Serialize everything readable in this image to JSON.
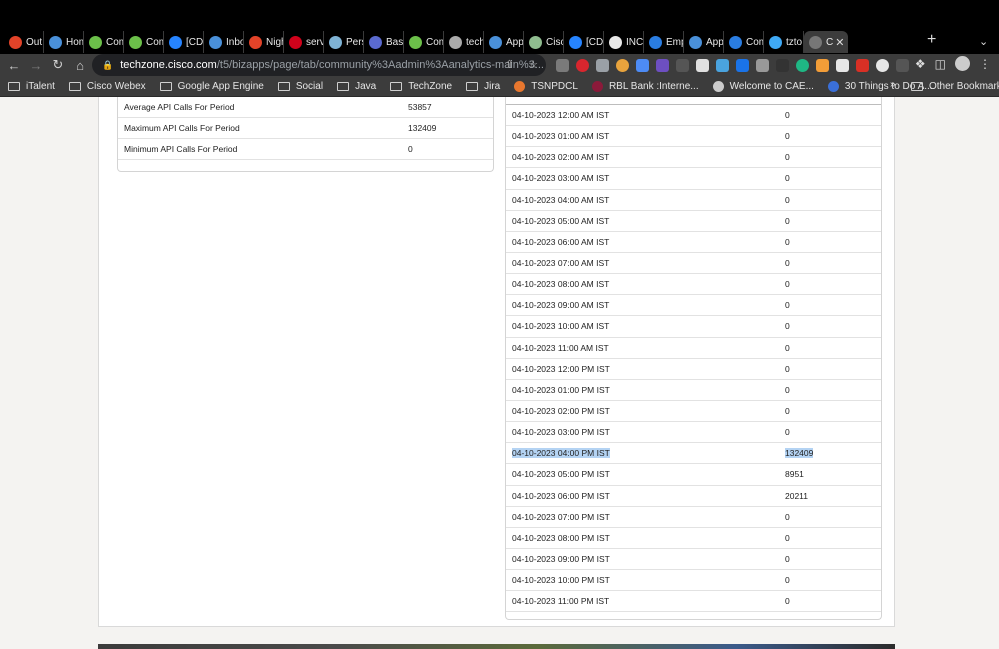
{
  "tabs": [
    {
      "label": "Out",
      "icon": "gitlab-icon",
      "color": "#e24329"
    },
    {
      "label": "Hom",
      "icon": "calendar-icon",
      "color": "#4a90d9"
    },
    {
      "label": "Com",
      "icon": "techzone-icon",
      "color": "#6cc04a"
    },
    {
      "label": "Com",
      "icon": "techzone-icon",
      "color": "#6cc04a"
    },
    {
      "label": "[CD",
      "icon": "jira-icon",
      "color": "#2684ff"
    },
    {
      "label": "Inbo",
      "icon": "confluence-icon",
      "color": "#4a90d9"
    },
    {
      "label": "Nigh",
      "icon": "gitlab-icon",
      "color": "#e24329"
    },
    {
      "label": "serv",
      "icon": "target-icon",
      "color": "#d0021b"
    },
    {
      "label": "Pers",
      "icon": "doc-icon",
      "color": "#7fb3d5"
    },
    {
      "label": "Bash",
      "icon": "atom-icon",
      "color": "#5a6acf"
    },
    {
      "label": "Com",
      "icon": "techzone-icon",
      "color": "#6cc04a"
    },
    {
      "label": "tech",
      "icon": "globe-icon",
      "color": "#aaaaaa"
    },
    {
      "label": "Appi",
      "icon": "confluence-icon",
      "color": "#4a90d9"
    },
    {
      "label": "Cisc",
      "icon": "cisco-icon",
      "color": "#8fbc8f"
    },
    {
      "label": "[CD",
      "icon": "jira-icon",
      "color": "#2684ff"
    },
    {
      "label": "INCI",
      "icon": "doc-icon",
      "color": "#e8e8e8"
    },
    {
      "label": "Emp",
      "icon": "cae-icon",
      "color": "#2a7de1"
    },
    {
      "label": "App",
      "icon": "confluence-icon",
      "color": "#4a90d9"
    },
    {
      "label": "Com",
      "icon": "shield-icon",
      "color": "#2a7de1"
    },
    {
      "label": "tzto",
      "icon": "feather-icon",
      "color": "#3fa9f5"
    }
  ],
  "active_tab": {
    "label": "C",
    "icon": "globe-icon"
  },
  "address_bar": {
    "host": "techzone.cisco.com",
    "path": "/t5/bizapps/page/tab/community%3Aadmin%3Aanalytics-main%3..."
  },
  "bookmarks": [
    {
      "label": "iTalent",
      "icon": "folder-icon"
    },
    {
      "label": "Cisco Webex",
      "icon": "folder-icon"
    },
    {
      "label": "Google App Engine",
      "icon": "folder-icon"
    },
    {
      "label": "Social",
      "icon": "folder-icon"
    },
    {
      "label": "Java",
      "icon": "folder-icon"
    },
    {
      "label": "TechZone",
      "icon": "folder-icon"
    },
    {
      "label": "Jira",
      "icon": "folder-icon"
    },
    {
      "label": "TSNPDCL",
      "icon": "tsnpdcl-icon"
    },
    {
      "label": "RBL Bank :Interne...",
      "icon": "rbl-icon"
    },
    {
      "label": "Welcome to CAE...",
      "icon": "globe-icon"
    },
    {
      "label": "30 Things to Do A...",
      "icon": "info-icon"
    }
  ],
  "other_bookmarks": "Other Bookmarks",
  "more_bookmarks": "»",
  "summary": [
    {
      "name": "Average API Calls For Period",
      "value": "53857"
    },
    {
      "name": "Maximum API Calls For Period",
      "value": "132409"
    },
    {
      "name": "Minimum API Calls For Period",
      "value": "0"
    }
  ],
  "hourly": [
    {
      "time": "04-10-2023 12:00 AM IST",
      "count": "0"
    },
    {
      "time": "04-10-2023 01:00 AM IST",
      "count": "0"
    },
    {
      "time": "04-10-2023 02:00 AM IST",
      "count": "0"
    },
    {
      "time": "04-10-2023 03:00 AM IST",
      "count": "0"
    },
    {
      "time": "04-10-2023 04:00 AM IST",
      "count": "0"
    },
    {
      "time": "04-10-2023 05:00 AM IST",
      "count": "0"
    },
    {
      "time": "04-10-2023 06:00 AM IST",
      "count": "0"
    },
    {
      "time": "04-10-2023 07:00 AM IST",
      "count": "0"
    },
    {
      "time": "04-10-2023 08:00 AM IST",
      "count": "0"
    },
    {
      "time": "04-10-2023 09:00 AM IST",
      "count": "0"
    },
    {
      "time": "04-10-2023 10:00 AM IST",
      "count": "0"
    },
    {
      "time": "04-10-2023 11:00 AM IST",
      "count": "0"
    },
    {
      "time": "04-10-2023 12:00 PM IST",
      "count": "0"
    },
    {
      "time": "04-10-2023 01:00 PM IST",
      "count": "0"
    },
    {
      "time": "04-10-2023 02:00 PM IST",
      "count": "0"
    },
    {
      "time": "04-10-2023 03:00 PM IST",
      "count": "0"
    },
    {
      "time": "04-10-2023 04:00 PM IST",
      "count": "132409",
      "highlighted": true
    },
    {
      "time": "04-10-2023 05:00 PM IST",
      "count": "8951"
    },
    {
      "time": "04-10-2023 06:00 PM IST",
      "count": "20211"
    },
    {
      "time": "04-10-2023 07:00 PM IST",
      "count": "0"
    },
    {
      "time": "04-10-2023 08:00 PM IST",
      "count": "0"
    },
    {
      "time": "04-10-2023 09:00 PM IST",
      "count": "0"
    },
    {
      "time": "04-10-2023 10:00 PM IST",
      "count": "0"
    },
    {
      "time": "04-10-2023 11:00 PM IST",
      "count": "0"
    }
  ],
  "colors": {
    "highlight": "#b4d3f3",
    "tabstrip": "#000000",
    "toolbar": "#3c3c3c"
  }
}
